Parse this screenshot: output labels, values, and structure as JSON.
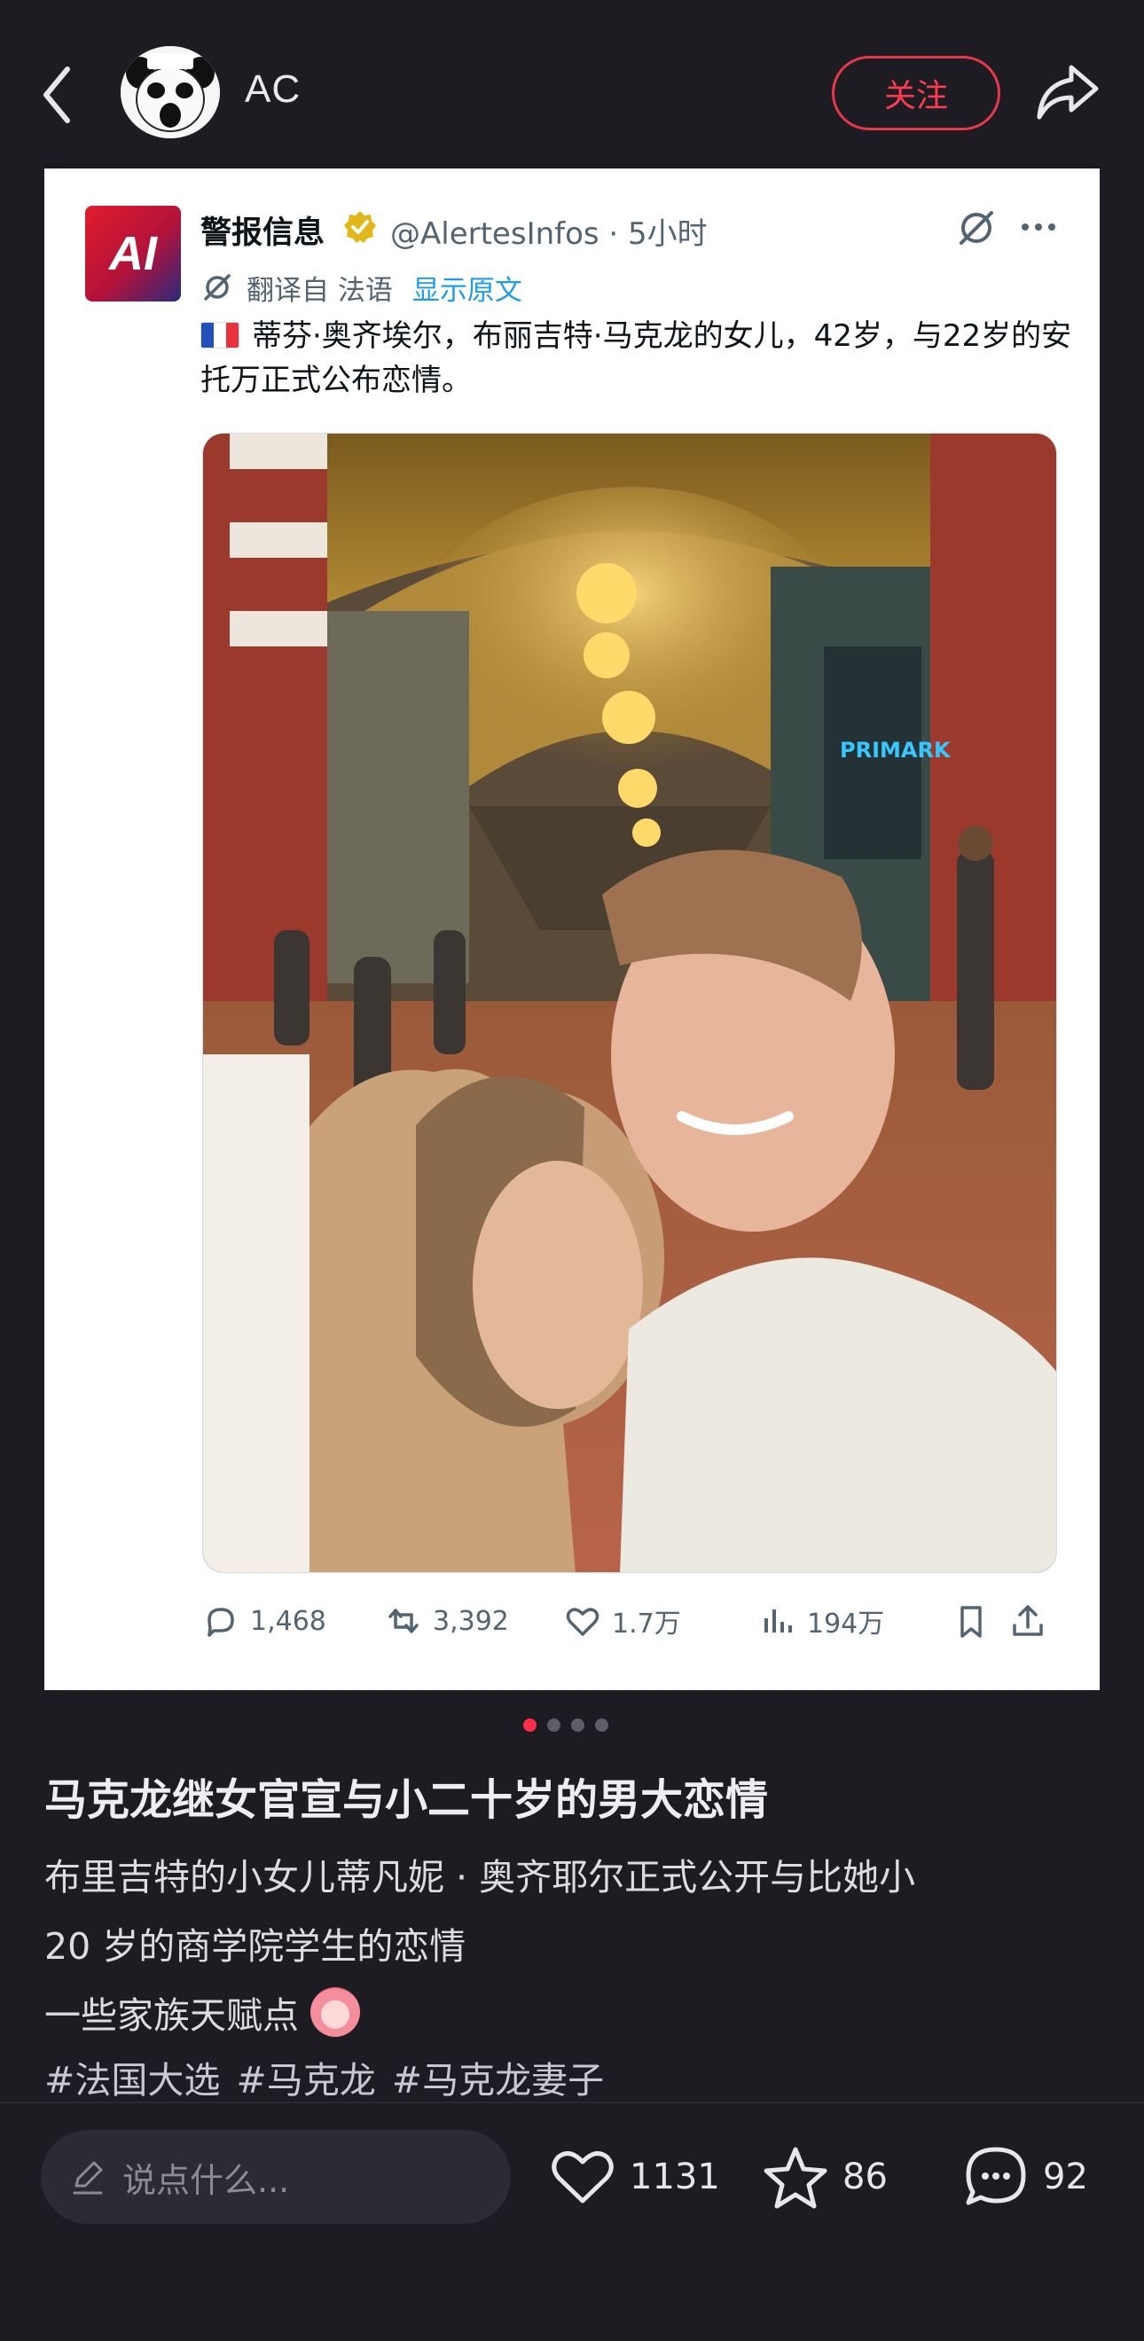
{
  "header": {
    "author": "AC",
    "follow_label": "关注",
    "avatar_caption": "Open mouth 目瞪口呆"
  },
  "post": {
    "source_logo_text": "AI",
    "source_name": "警报信息",
    "source_handle": "@AlertesInfos · 5小时",
    "translate_label": "翻译自 法语",
    "show_original_label": "显示原文",
    "text": "蒂芬·奥齐埃尔，布丽吉特·马克龙的女儿，42岁，与22岁的安托万正式公布恋情。",
    "photo_sign": "PRIMARK",
    "stats": {
      "replies": "1,468",
      "retweets": "3,392",
      "likes": "1.7万",
      "views": "194万"
    }
  },
  "pager": {
    "total": 4,
    "active": 1
  },
  "note": {
    "title": "马克龙继女官宣与小二十岁的男大恋情",
    "desc_line1": "布里吉特的小女儿蒂凡妮 · 奥齐耶尔正式公开与比她小",
    "desc_line2": " 20 岁的商学院学生的恋情",
    "desc_line3": "一些家族天赋点",
    "tags": [
      "#法国大选",
      "#马克龙",
      "#马克龙妻子"
    ]
  },
  "bottom_bar": {
    "comment_placeholder": "说点什么...",
    "likes": "1131",
    "favorites": "86",
    "comments": "92"
  },
  "colors": {
    "background": "#1c1c22",
    "accent": "#ff2e4d",
    "link_blue": "#1d9bf0"
  }
}
